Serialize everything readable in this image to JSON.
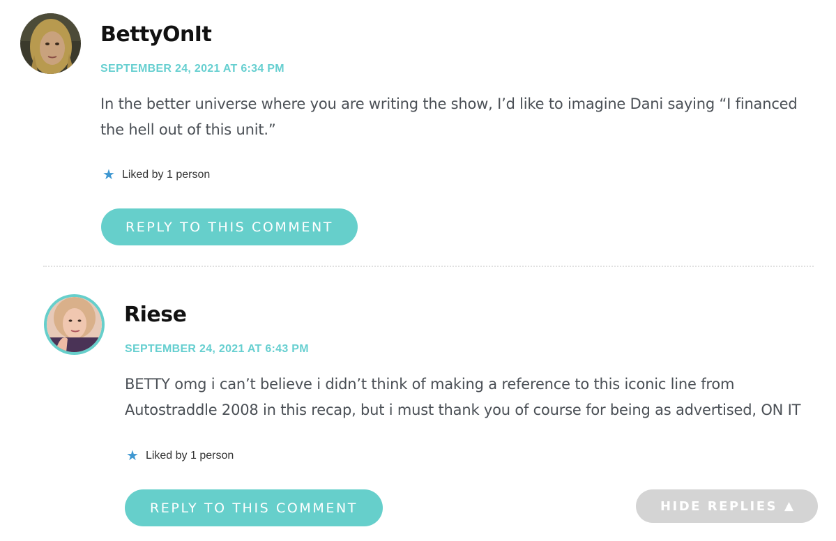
{
  "comments": [
    {
      "author": "BettyOnIt",
      "date": "SEPTEMBER 24, 2021 AT 6:34 PM",
      "text": "In the better universe where you are writing the show, I’d like to imagine Dani saying “I financed the hell out of this unit.”",
      "likes": "Liked by 1 person",
      "reply_label": "REPLY TO THIS COMMENT"
    },
    {
      "author": "Riese",
      "date": "SEPTEMBER 24, 2021 AT 6:43 PM",
      "text": "BETTY omg i can’t believe i didn’t think of making a reference to this iconic line from Autostraddle 2008 in this recap, but i must thank you of course for being as advertised, ON IT",
      "likes": "Liked by 1 person",
      "reply_label": "REPLY TO THIS COMMENT"
    }
  ],
  "hide_replies": {
    "label": "HIDE REPLIES",
    "icon": "triangle-up-icon",
    "glyph": "▲"
  },
  "colors": {
    "accent": "#66cfcb",
    "date": "#66cfd0",
    "star": "#3e97d1",
    "hide_button": "#d4d4d4",
    "body_text": "#4a4f55"
  }
}
